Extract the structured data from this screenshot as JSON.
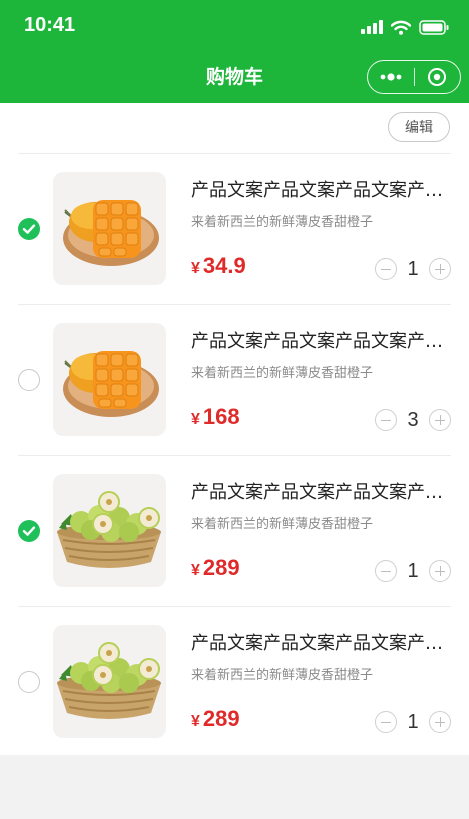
{
  "status_bar": {
    "time": "10:41"
  },
  "nav": {
    "title": "购物车"
  },
  "toolbar": {
    "edit_label": "编辑"
  },
  "currency": "¥",
  "colors": {
    "brand": "#1db53a",
    "check": "#1fbf5a",
    "price": "#e02a2a"
  },
  "items": [
    {
      "title": "产品文案产品文案产品文案产品文案",
      "subtitle": "来着新西兰的新鲜薄皮香甜橙子",
      "price": "34.9",
      "qty": "1",
      "selected": true,
      "image": "mango-image"
    },
    {
      "title": "产品文案产品文案产品文案产品文案",
      "subtitle": "来着新西兰的新鲜薄皮香甜橙子",
      "price": "168",
      "qty": "3",
      "selected": false,
      "image": "mango-image"
    },
    {
      "title": "产品文案产品文案产品文案产品文案",
      "subtitle": "来着新西兰的新鲜薄皮香甜橙子",
      "price": "289",
      "qty": "1",
      "selected": true,
      "image": "jujube-basket-image"
    },
    {
      "title": "产品文案产品文案产品文案产品文案",
      "subtitle": "来着新西兰的新鲜薄皮香甜橙子",
      "price": "289",
      "qty": "1",
      "selected": false,
      "image": "jujube-basket-image"
    }
  ]
}
